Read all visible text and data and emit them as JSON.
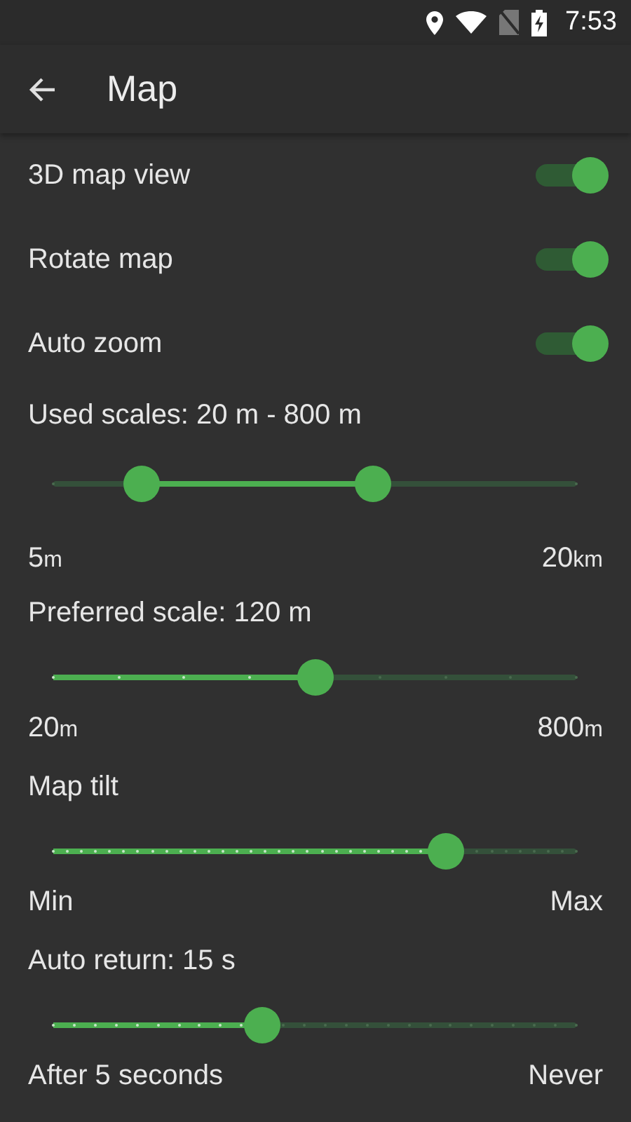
{
  "status_bar": {
    "time": "7:53"
  },
  "toolbar": {
    "title": "Map"
  },
  "toggles": [
    {
      "label": "3D map view",
      "on": true
    },
    {
      "label": "Rotate map",
      "on": true
    },
    {
      "label": "Auto zoom",
      "on": true
    }
  ],
  "sliders": [
    {
      "kind": "range",
      "label": "Used scales: 20 m - 800 m",
      "thumbs": [
        {
          "level": 0.17
        },
        {
          "level": 0.61
        }
      ],
      "min": {
        "value": "5",
        "unit": "m"
      },
      "max": {
        "value": "20",
        "unit": "km"
      }
    },
    {
      "kind": "stepped",
      "label": "Preferred scale: 120 m",
      "level": 0.5,
      "min": {
        "value": "20",
        "unit": "m"
      },
      "max": {
        "value": "800",
        "unit": "m"
      }
    },
    {
      "kind": "stepped",
      "label": "Map tilt",
      "level": 0.75,
      "min": {
        "value": "Min"
      },
      "max": {
        "value": "Max"
      }
    },
    {
      "kind": "stepped",
      "label": "Auto return: 15 s",
      "level": 0.4,
      "min": {
        "value": "After 5 seconds"
      },
      "max": {
        "value": "Never"
      }
    }
  ]
}
